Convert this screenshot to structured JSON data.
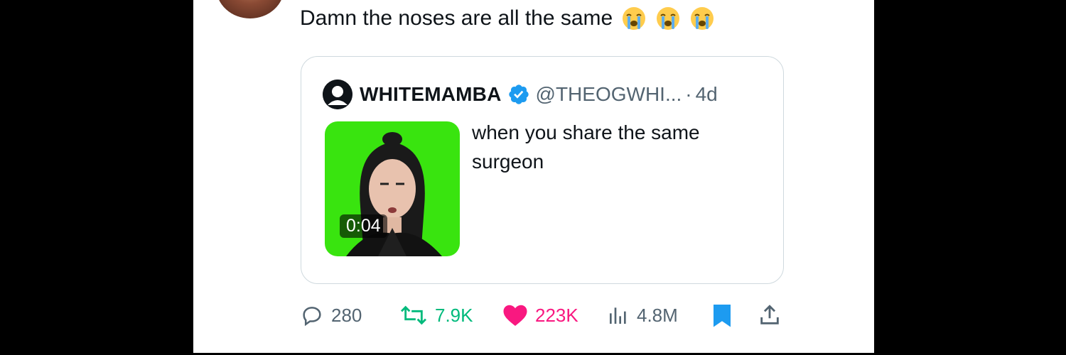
{
  "tweet": {
    "text": "Damn the noses are all the same",
    "emojis": [
      "loudly-crying-face-icon",
      "loudly-crying-face-icon",
      "loudly-crying-face-icon"
    ]
  },
  "quote": {
    "display_name": "WHITEMAMBA",
    "handle": "@THEOGWHI...",
    "separator": "·",
    "time": "4d",
    "text": "when you share the same surgeon",
    "media": {
      "duration": "0:04",
      "background_color": "#39e40f"
    }
  },
  "actions": {
    "replies": "280",
    "retweets": "7.9K",
    "likes": "223K",
    "views": "4.8M"
  },
  "colors": {
    "retweet": "#00ba7c",
    "like": "#f91880",
    "bookmark": "#1d9bf0",
    "text_secondary": "#536471",
    "text_primary": "#0f1419"
  }
}
